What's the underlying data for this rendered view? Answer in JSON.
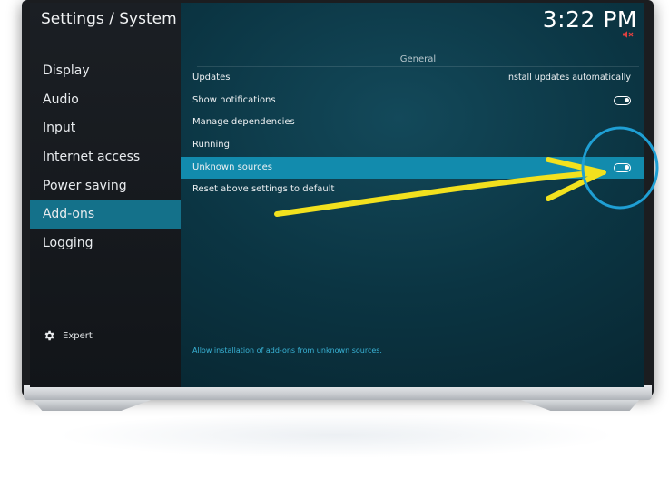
{
  "header": {
    "title": "Settings / System",
    "clock": "3:22 PM"
  },
  "sidebar": {
    "items": [
      {
        "label": "Display",
        "active": false
      },
      {
        "label": "Audio",
        "active": false
      },
      {
        "label": "Input",
        "active": false
      },
      {
        "label": "Internet access",
        "active": false
      },
      {
        "label": "Power saving",
        "active": false
      },
      {
        "label": "Add-ons",
        "active": true
      },
      {
        "label": "Logging",
        "active": false
      }
    ],
    "expert_label": "Expert"
  },
  "settings": {
    "section": "General",
    "rows": [
      {
        "label": "Updates",
        "value": "Install updates automatically"
      },
      {
        "label": "Show notifications",
        "toggle": "on"
      },
      {
        "label": "Manage dependencies"
      },
      {
        "label": "Running"
      },
      {
        "label": "Unknown sources",
        "toggle": "on",
        "selected": true
      },
      {
        "label": "Reset above settings to default"
      }
    ],
    "description": "Allow installation of add-ons from unknown sources."
  },
  "icons": [
    "gear-icon",
    "mute-icon",
    "toggle-icon"
  ],
  "colors": {
    "accent": "#14718a",
    "selected_row": "#128bad",
    "annotation_arrow": "#f2e11e",
    "annotation_circle": "#1f9fd4"
  }
}
